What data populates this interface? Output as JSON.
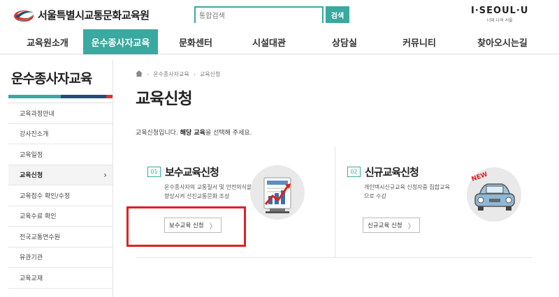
{
  "header": {
    "logo_text": "서울특별시교통문화교육원",
    "search_placeholder": "통합검색",
    "search_button": "검색",
    "seoul_logo": "I·SEOUL·U",
    "seoul_tagline": "너와 나의 서울"
  },
  "nav": {
    "items": [
      "교육원소개",
      "운수종사자교육",
      "문화센터",
      "시설대관",
      "상담실",
      "커뮤니티",
      "찾아오시는길"
    ],
    "active_index": 1
  },
  "sidebar": {
    "title": "운수종사자교육",
    "items": [
      "교육과정안내",
      "강사진소개",
      "교육일정",
      "교육신청",
      "교육접수 확인/수정",
      "교육수료 확인",
      "전국교통연수원",
      "유관기관",
      "교육교재"
    ],
    "active_index": 3,
    "active_chevron": "›"
  },
  "breadcrumb": {
    "items": [
      "운수종사자교육",
      "교육신청"
    ],
    "home_icon": "home-icon"
  },
  "page_title": "교육신청",
  "intro": {
    "before": "교육신청입니다. ",
    "bold": "해당 교육",
    "after": "을 선택해 주세요."
  },
  "cards": [
    {
      "num": "01",
      "title": "보수교육신청",
      "desc": "운수종사자의 교통질서 및 안전의식을 향상시켜 선진교통문화 조성",
      "button": "보수교육 신청",
      "arrow": "〉",
      "icon": "chart-monitor-icon"
    },
    {
      "num": "02",
      "title": "신규교육신청",
      "desc": "개인택시신규교육 신청자중 집합교육으로 수강",
      "button": "신규교육 신청",
      "arrow": "〉",
      "icon": "new-car-icon",
      "badge": "NEW"
    }
  ],
  "colors": {
    "accent": "#3aa9a0",
    "highlight": "#e02020",
    "navy": "#1f4f7a",
    "red": "#d9342b"
  }
}
